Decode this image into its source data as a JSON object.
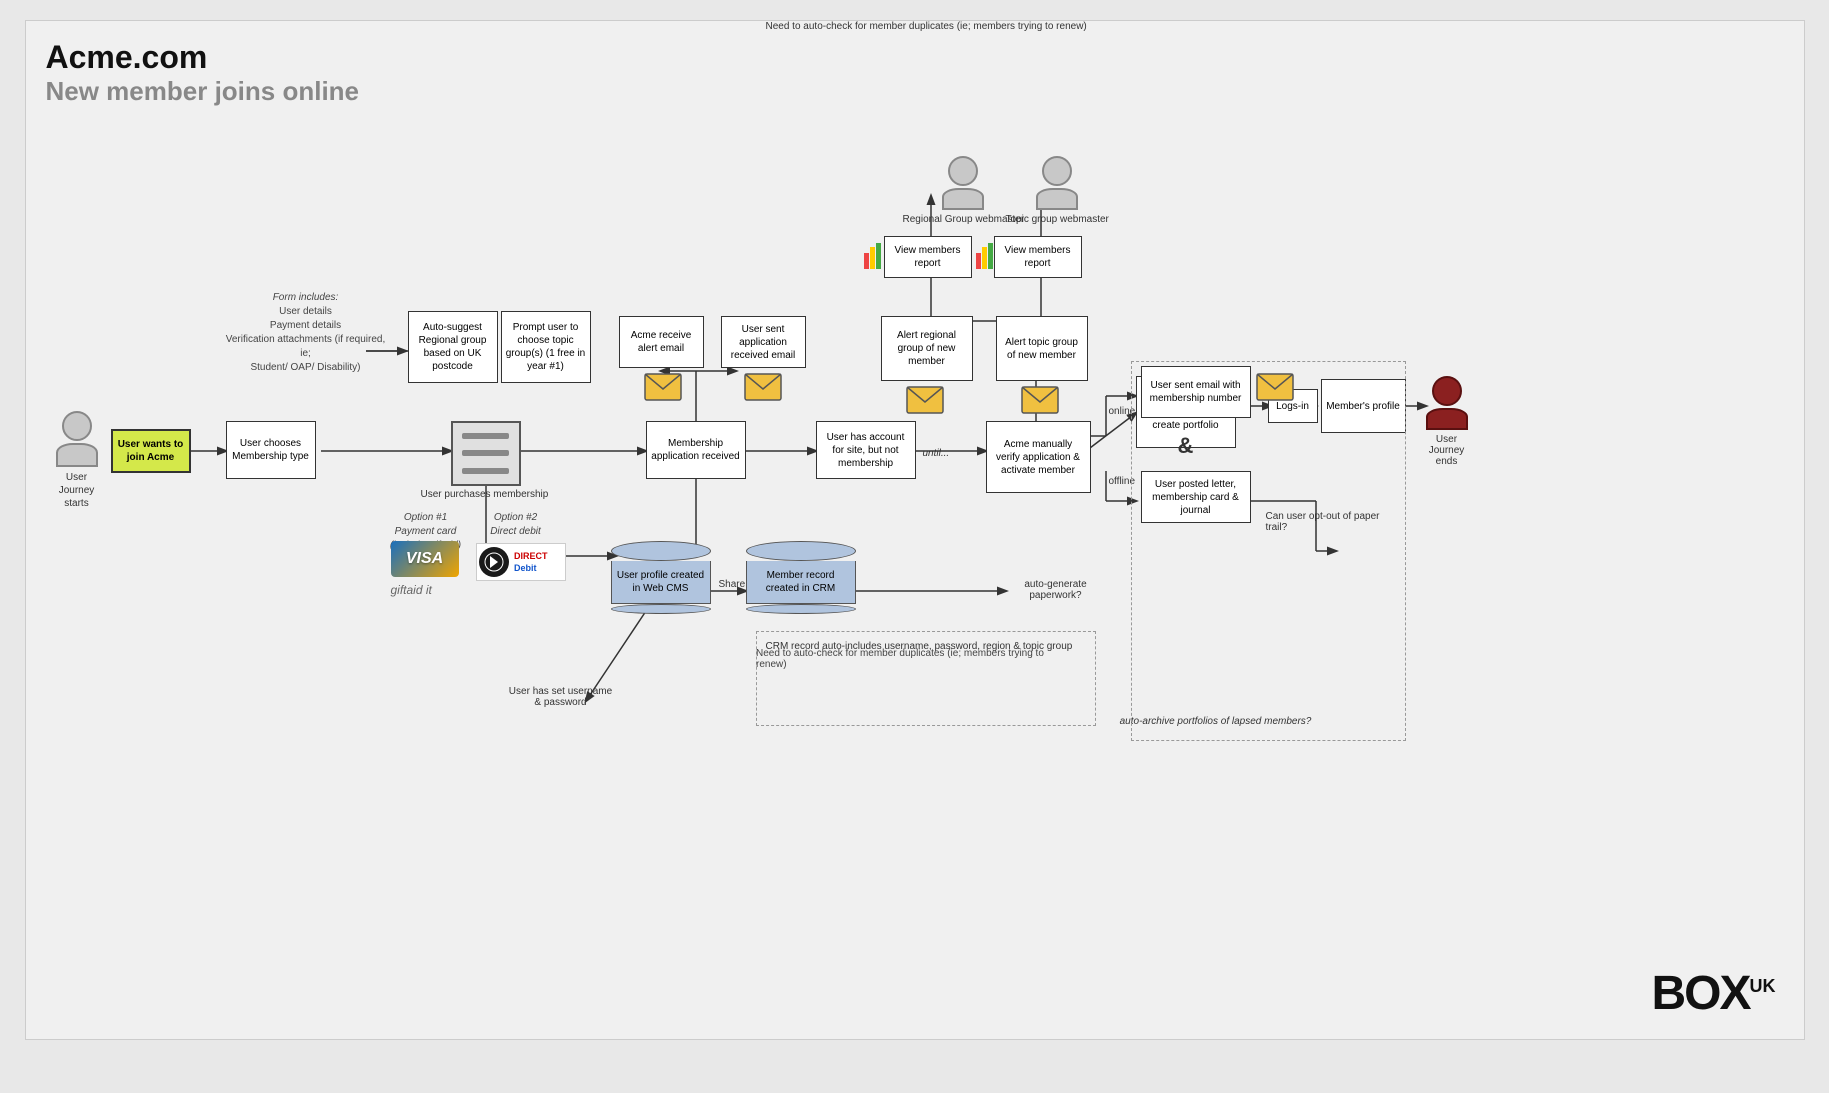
{
  "title": {
    "main": "Acme.com",
    "sub": "New member joins online"
  },
  "nodes": {
    "user_journey_starts_label": "User Journey starts",
    "user_wants_join": "User wants to join Acme",
    "user_chooses_membership": "User chooses Membership type",
    "auto_suggest_regional": "Auto-suggest Regional group based on UK postcode",
    "prompt_topic_group": "Prompt user to choose topic group(s) (1 free in year #1)",
    "user_purchases": "User purchases membership",
    "membership_received": "Membership application received",
    "acme_receive_alert": "Acme receive alert email",
    "user_sent_application": "User sent application received email",
    "user_has_account": "User has account for site, but not membership",
    "acme_manually_verify": "Acme manually verify application & activate member",
    "alert_regional": "Alert regional group of new member",
    "alert_topic": "Alert topic group of new member",
    "regional_webmaster": "Regional Group webmaster",
    "topic_webmaster": "Topic group webmaster",
    "view_members_regional": "View members report",
    "view_members_topic": "View members report",
    "prompt_complete_profile": "Prompt user to complete full profile/ create portfolio",
    "logs_in": "Logs-in",
    "members_profile": "Member's profile",
    "user_journey_ends_label": "User Journey ends",
    "user_sent_email_membership": "User sent email with membership number",
    "user_posted_letter": "User posted letter, membership card & journal",
    "user_profile_web_cms": "User profile created in Web CMS",
    "member_record_crm": "Member record created in CRM",
    "user_has_set": "User has set username & password",
    "option1_label": "Option #1\nPayment card\n(include GiftAid)",
    "option2_label": "Option #2\nDirect debit",
    "can_opt_out": "Can user opt-out of paper trail?",
    "auto_generate": "auto-generate paperwork?",
    "auto_archive": "auto-archive portfolios of lapsed members?",
    "crm_note1": "CRM record auto-includes username, password, region & topic group",
    "crm_note2": "Need to auto-check for member duplicates (ie; members trying to renew)",
    "form_includes_label": "Form includes:",
    "form_details": "User details\nPayment details\nVerification attachments (if required, ie;\nStudent/ OAP/ Disability)",
    "share_data": "Share data",
    "until_label": "until...",
    "online_label": "online",
    "offline_label": "offline",
    "amp_symbol": "&",
    "giftaid": "giftaid it",
    "visa_label": "VISA",
    "direct_debit_label": "DIRECT Debit"
  },
  "colors": {
    "box_border": "#333",
    "box_bg": "#ffffff",
    "yellow_bg": "#d4e84a",
    "person_fill": "#bbbbbb",
    "person_dark": "#777777",
    "envelope_yellow": "#f0c040",
    "db_fill": "#b0c4de",
    "server_fill": "#d0d0d0",
    "connector": "#333333",
    "note_color": "#444444"
  },
  "logo": {
    "text": "BOX",
    "superscript": "UK"
  }
}
